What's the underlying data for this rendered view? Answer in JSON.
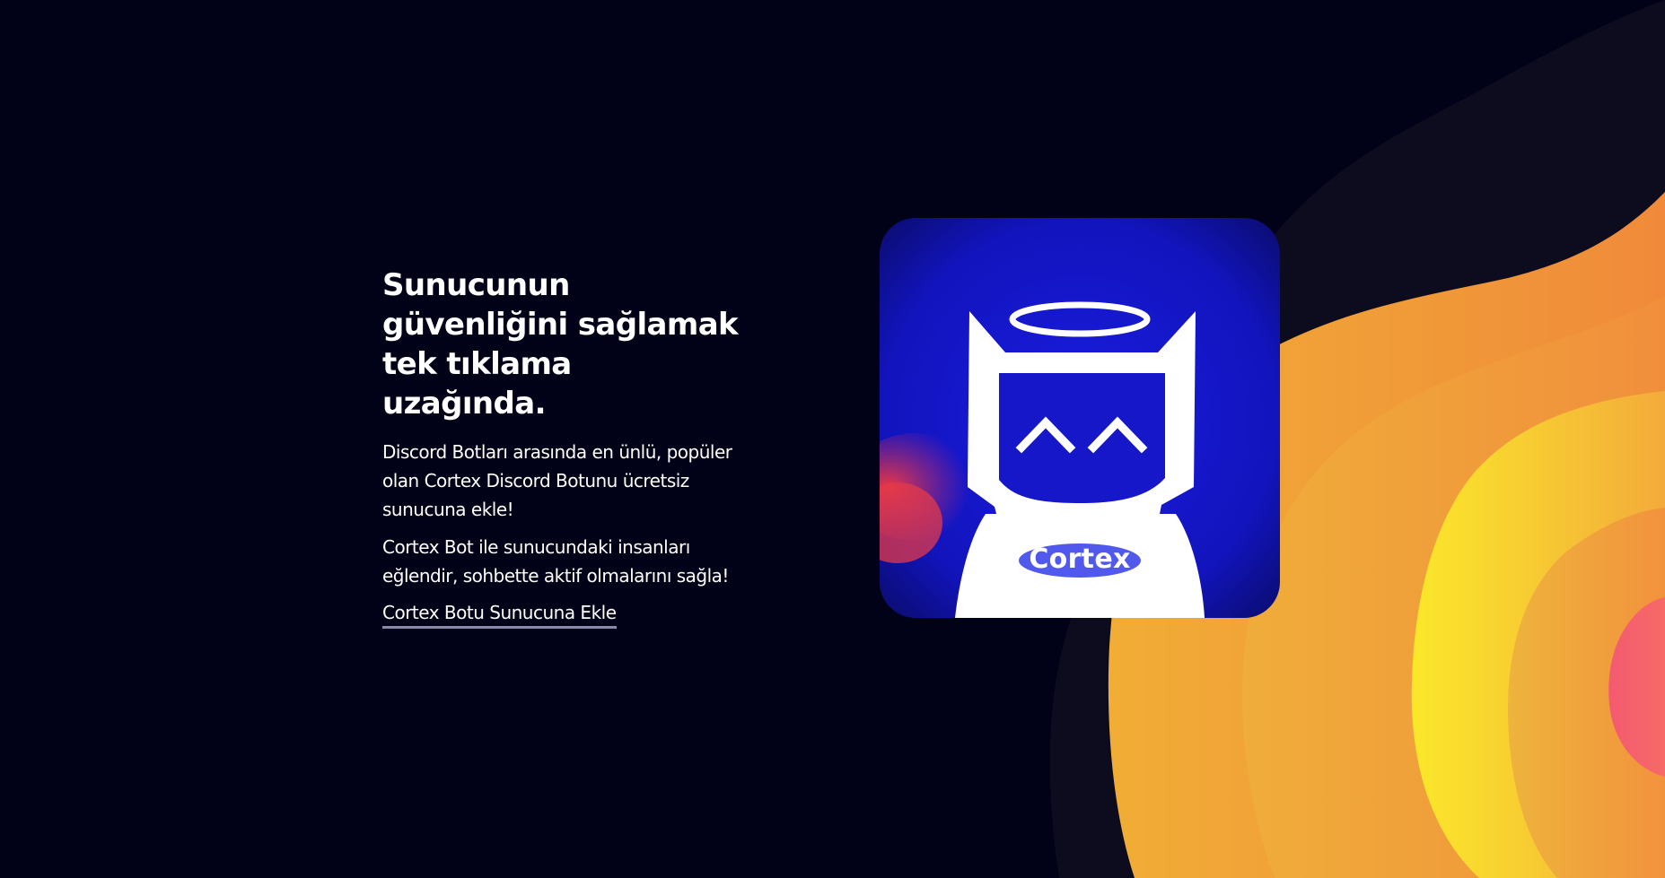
{
  "hero": {
    "title_line1": "Sunucunun",
    "title_line2": "güvenliğini sağlamak",
    "title_line3": "tek tıklama uzağında.",
    "paragraph1": "Discord Botları arasında en ünlü, popüler olan Cortex Discord Botunu ücretsiz sunucuna ekle!",
    "paragraph2": "Cortex Bot ile sunucundaki insanları eğlendir, sohbette aktif olmalarını sağla!",
    "cta_label": "Cortex Botu Sunucuna Ekle"
  },
  "bot_image": {
    "shirt_text": "Cortex"
  },
  "colors": {
    "background": "#010118",
    "wave_dark": "#0d0c1f",
    "wave_orange": "#f0a23c",
    "wave_yellow": "#f8d534",
    "wave_pink": "#f2596e",
    "card_blue": "#1416c6",
    "link_underline": "#8a8aa8"
  },
  "icons": {
    "bot_avatar": "cortex-bot-avatar-icon"
  }
}
